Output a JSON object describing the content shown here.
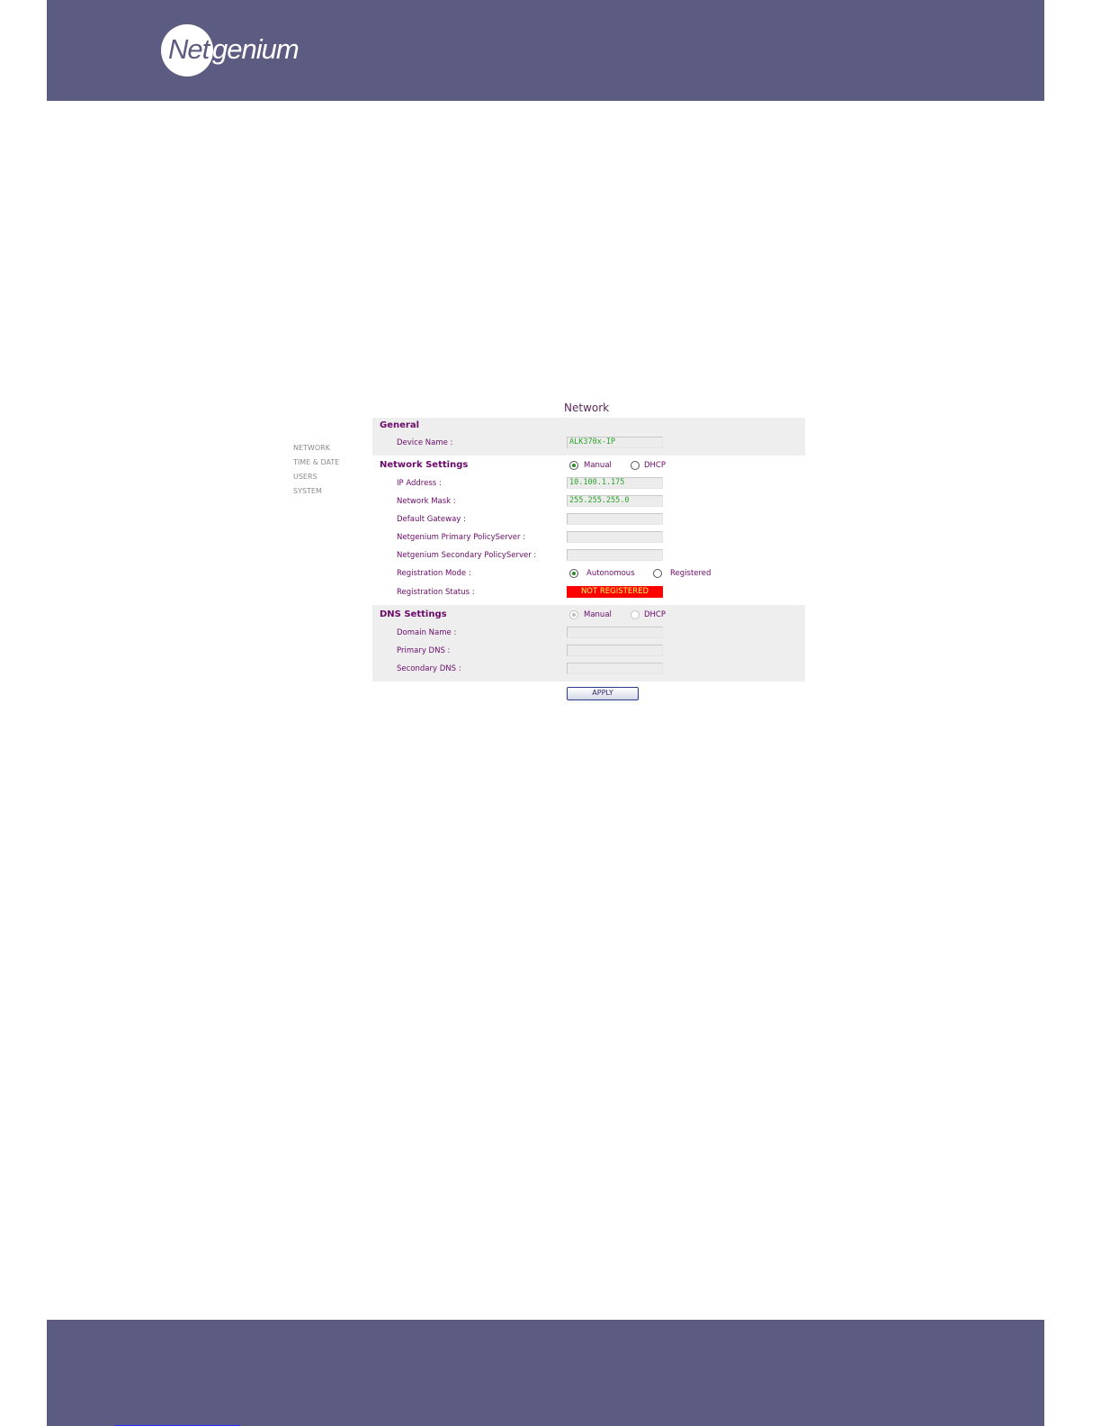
{
  "brand": {
    "logo_prefix": "Net",
    "logo_suffix": "genium"
  },
  "page": {
    "title": "Network"
  },
  "sidebar": {
    "items": [
      {
        "label": "NETWORK"
      },
      {
        "label": "TIME & DATE"
      },
      {
        "label": "USERS"
      },
      {
        "label": "SYSTEM"
      }
    ]
  },
  "general": {
    "title": "General",
    "device_name_label": "Device Name :",
    "device_name_value": "ALK370x-IP"
  },
  "network_settings": {
    "title": "Network Settings",
    "mode_options": [
      {
        "label": "Manual",
        "selected": true
      },
      {
        "label": "DHCP",
        "selected": false
      }
    ],
    "ip_label": "IP Address :",
    "ip_value": "10.100.1.175",
    "mask_label": "Network Mask :",
    "mask_value": "255.255.255.0",
    "gateway_label": "Default Gateway :",
    "gateway_value": "",
    "primary_ps_label": "Netgenium Primary PolicyServer :",
    "primary_ps_value": "",
    "secondary_ps_label": "Netgenium Secondary PolicyServer :",
    "secondary_ps_value": "",
    "reg_mode_label": "Registration Mode :",
    "reg_mode_options": [
      {
        "label": "Autonomous",
        "selected": true
      },
      {
        "label": "Registered",
        "selected": false
      }
    ],
    "reg_status_label": "Registration Status :",
    "reg_status_value": "NOT REGISTERED"
  },
  "dns_settings": {
    "title": "DNS Settings",
    "mode_options": [
      {
        "label": "Manual",
        "selected": true
      },
      {
        "label": "DHCP",
        "selected": false
      }
    ],
    "domain_label": "Domain Name :",
    "domain_value": "",
    "primary_label": "Primary DNS :",
    "primary_value": "",
    "secondary_label": "Secondary DNS :",
    "secondary_value": ""
  },
  "actions": {
    "apply_label": "APPLY"
  },
  "colors": {
    "header_band": "#5c5c82",
    "label_text": "#6a0a6a",
    "field_value_text": "#2aa52a",
    "status_bg": "#ff0000",
    "status_text": "#ffff55"
  }
}
